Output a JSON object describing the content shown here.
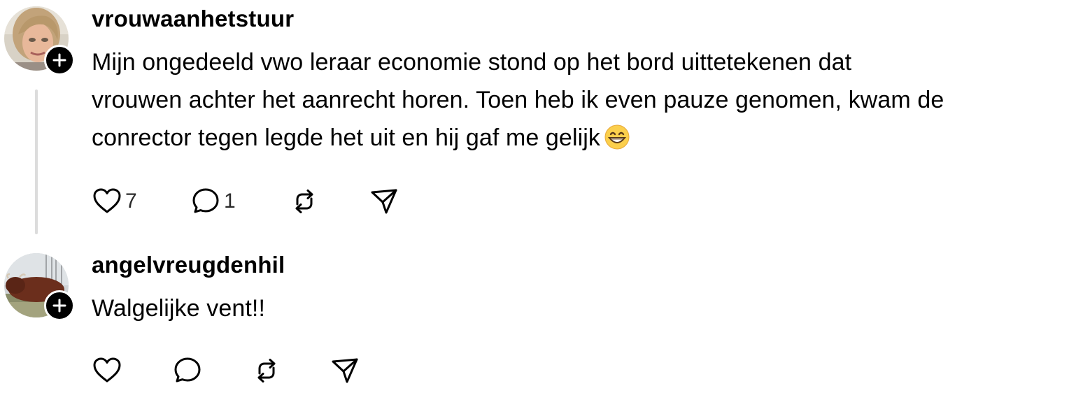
{
  "thread": {
    "posts": [
      {
        "username": "vrouwaanhetstuur",
        "text_lines": [
          "Mijn ongedeeld vwo leraar economie stond op het bord uittetekenen dat",
          "vrouwen achter het aanrecht horen. Toen heb ik even pauze genomen, kwam de",
          "conrector tegen legde het uit en hij gaf me gelijk"
        ],
        "emoji": "grinning-face-with-smiling-eyes",
        "likes": "7",
        "replies": "1",
        "reposts": "",
        "avatar": "woman-portrait"
      },
      {
        "username": "angelvreugdenhil",
        "text_lines": [
          "Walgelijke vent!!"
        ],
        "likes": "",
        "replies": "",
        "reposts": "",
        "avatar": "brown-cow-in-field"
      }
    ]
  },
  "icons": {
    "like": "heart-icon",
    "reply": "comment-icon",
    "repost": "repost-icon",
    "share": "send-icon",
    "follow": "plus-icon"
  },
  "colors": {
    "text": "#000000",
    "thread_line": "#dcdcdc",
    "badge": "#000000"
  }
}
